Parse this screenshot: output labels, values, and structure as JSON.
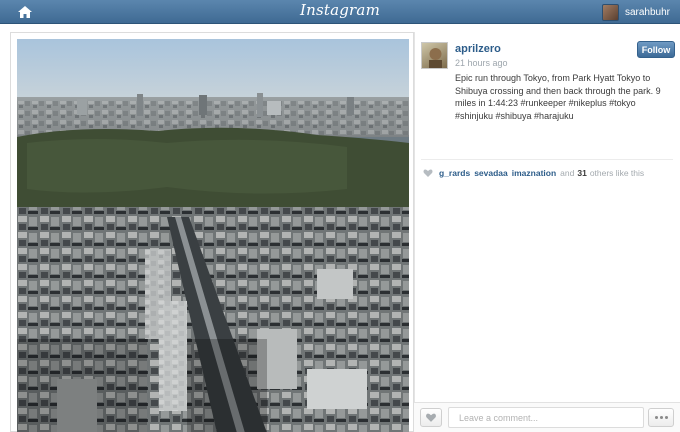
{
  "header": {
    "logo_text": "Instagram",
    "home_icon": "home-icon",
    "username": "sarahbuhr"
  },
  "post": {
    "author": "aprilzero",
    "time": "21 hours ago",
    "follow_label": "Follow",
    "caption": "Epic run through Tokyo, from Park Hyatt Tokyo to Shibuya crossing and then back through the park. 9 miles in 1:44:23 #runkeeper #nikeplus #tokyo #shinjuku #shibuya #harajuku",
    "likes": {
      "users": [
        "g_rards",
        "sevadaa",
        "imaznation"
      ],
      "and_text": "and",
      "others_count": "31",
      "others_text": "others like this"
    }
  },
  "comment_bar": {
    "placeholder": "Leave a comment...",
    "like_icon": "heart-icon",
    "more_icon": "ellipsis-icon"
  },
  "colors": {
    "topbar": "#4c77a0",
    "link": "#2d5d8a",
    "follow_button": "#4f7dab"
  }
}
